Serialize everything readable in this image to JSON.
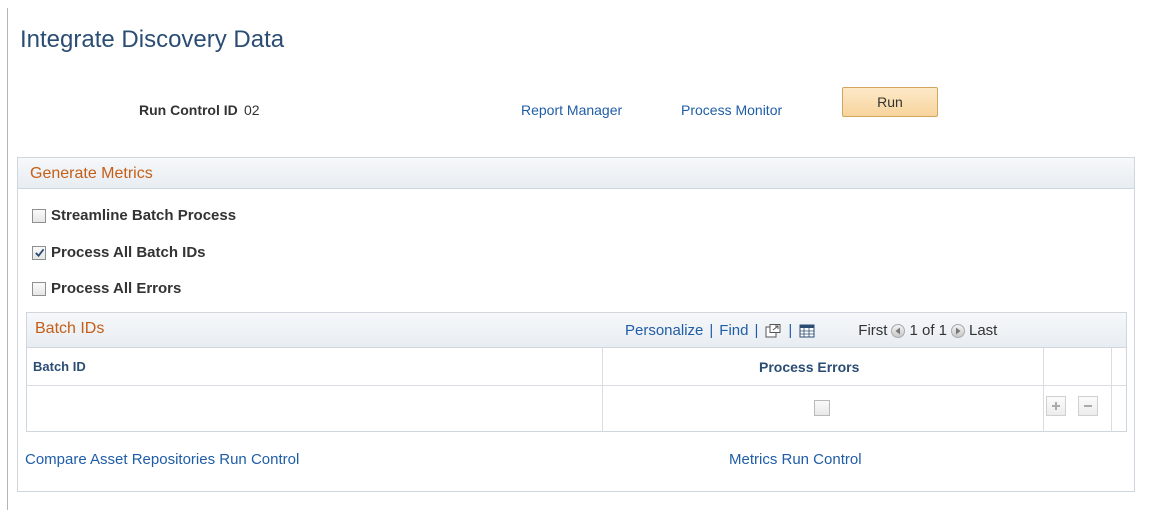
{
  "page": {
    "title": "Integrate Discovery Data"
  },
  "run_control": {
    "label": "Run Control ID",
    "value": "02",
    "report_manager": "Report Manager",
    "process_monitor": "Process Monitor",
    "run_label": "Run"
  },
  "generate_metrics": {
    "title": "Generate Metrics",
    "options": [
      {
        "label": "Streamline Batch Process",
        "checked": false
      },
      {
        "label": "Process All Batch IDs",
        "checked": true
      },
      {
        "label": "Process All Errors",
        "checked": false
      }
    ]
  },
  "batch_grid": {
    "title": "Batch IDs",
    "personalize": "Personalize",
    "find": "Find",
    "first": "First",
    "pager": "1 of 1",
    "last": "Last",
    "columns": [
      "Batch ID",
      "Process Errors"
    ],
    "rows": [
      {
        "batch_id": "",
        "process_errors": false
      }
    ]
  },
  "links": {
    "compare": "Compare Asset Repositories Run Control",
    "metrics": "Metrics Run Control"
  },
  "colors": {
    "title": "#2b4d74",
    "link": "#1f5da6",
    "section_title": "#c55e17",
    "run_button": "#f7d49c"
  },
  "icons": {
    "checked": "checkmark-icon",
    "new_window": "new-window-icon",
    "download": "spreadsheet-icon",
    "prev": "arrow-left-icon",
    "next": "arrow-right-icon",
    "add_row": "plus-icon",
    "delete_row": "minus-icon"
  }
}
